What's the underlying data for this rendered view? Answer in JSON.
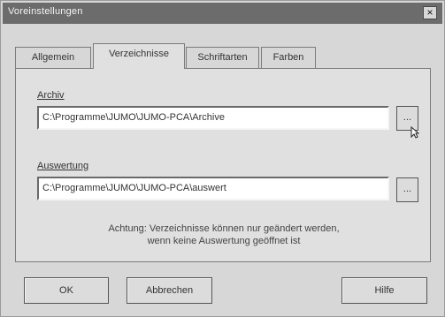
{
  "window": {
    "title": "Voreinstellungen",
    "close_glyph": "×"
  },
  "tabs": [
    {
      "label": "Allgemein"
    },
    {
      "label": "Verzeichnisse"
    },
    {
      "label": "Schriftarten"
    },
    {
      "label": "Farben"
    }
  ],
  "panel": {
    "archive_label": "Archiv",
    "archive_value": "C:\\Programme\\JUMO\\JUMO-PCA\\Archive",
    "auswertung_label": "Auswertung",
    "auswertung_value": "C:\\Programme\\JUMO\\JUMO-PCA\\auswert",
    "browse_glyph": "...",
    "note_line1": "Achtung: Verzeichnisse können nur geändert werden,",
    "note_line2": "wenn keine Auswertung geöffnet ist"
  },
  "buttons": {
    "ok": "OK",
    "cancel": "Abbrechen",
    "help": "Hilfe"
  }
}
